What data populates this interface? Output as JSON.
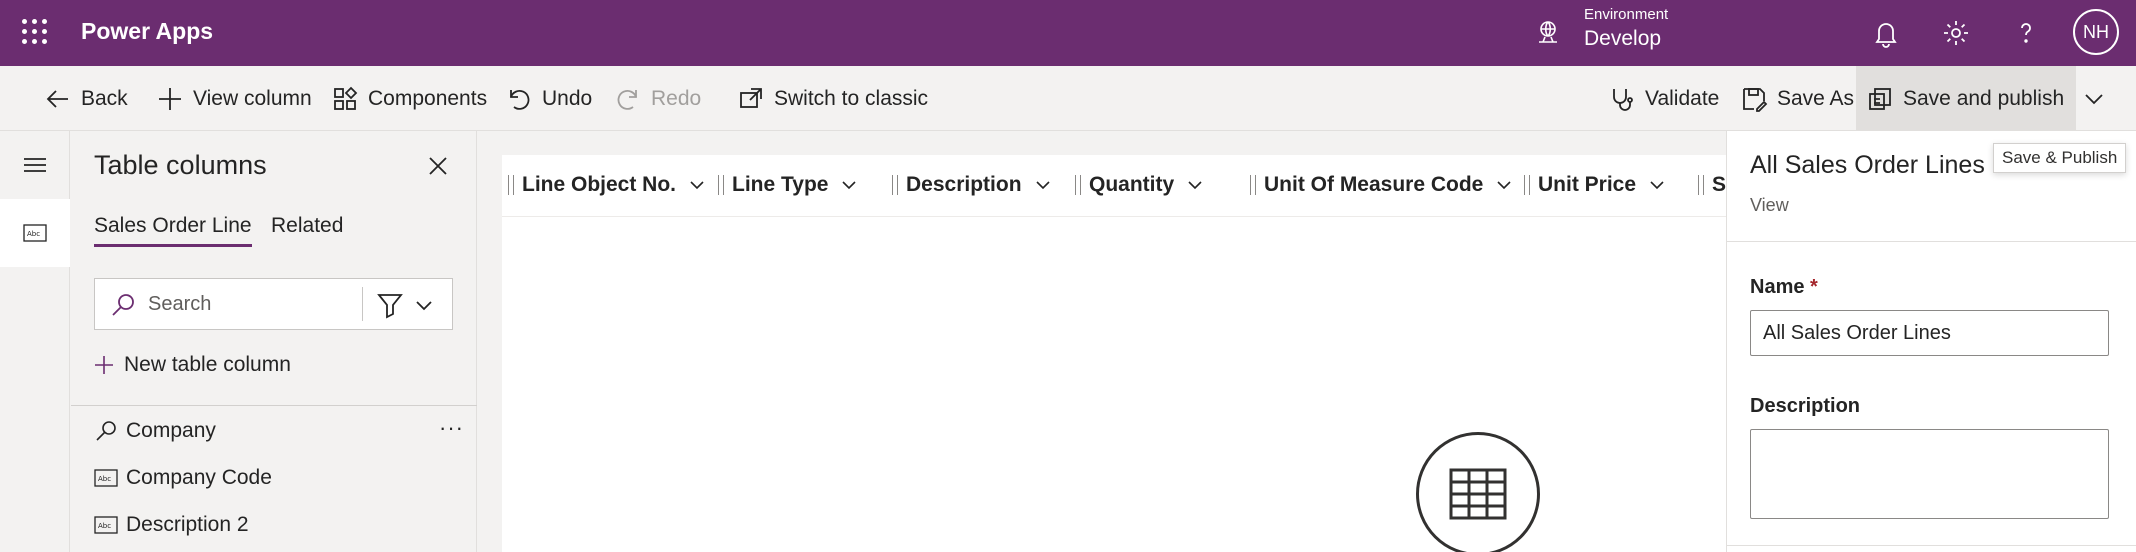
{
  "header": {
    "app_title": "Power Apps",
    "environment_label": "Environment",
    "environment_value": "Develop",
    "avatar_initials": "NH",
    "brand_color": "#6b2d70"
  },
  "commandbar": {
    "back": "Back",
    "view_column": "View column",
    "components": "Components",
    "undo": "Undo",
    "redo": "Redo",
    "switch_classic": "Switch to classic",
    "validate": "Validate",
    "save_as": "Save As",
    "save_publish": "Save and publish",
    "tooltip": "Save & Publish"
  },
  "columns_panel": {
    "title": "Table columns",
    "tabs": [
      "Sales Order Line",
      "Related"
    ],
    "search_placeholder": "Search",
    "new_column": "New table column",
    "fields": [
      {
        "label": "Company",
        "icon": "lookup-icon"
      },
      {
        "label": "Company Code",
        "icon": "text-field-icon"
      },
      {
        "label": "Description 2",
        "icon": "text-field-icon"
      }
    ]
  },
  "grid": {
    "columns": [
      "Line Object No.",
      "Line Type",
      "Description",
      "Quantity",
      "Unit Of Measure Code",
      "Unit Price",
      "Sh"
    ]
  },
  "properties": {
    "title": "All Sales Order Lines",
    "subtitle": "View",
    "name_label": "Name",
    "required_mark": "*",
    "name_value": "All Sales Order Lines",
    "description_label": "Description",
    "description_value": ""
  }
}
